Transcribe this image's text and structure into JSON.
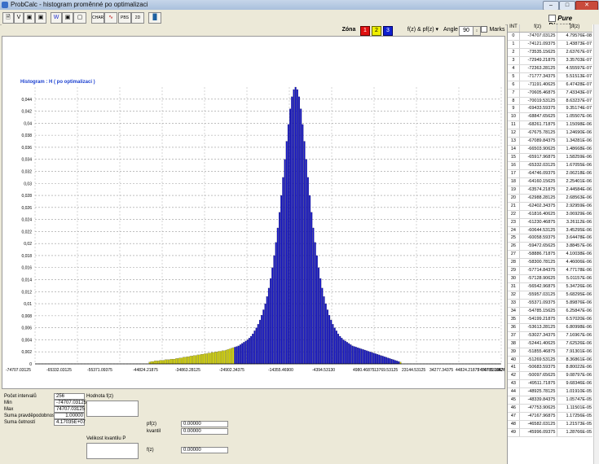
{
  "window": {
    "title": "ProbCalc - histogram proměnné po optimalizaci"
  },
  "toolbar": {
    "buttons": [
      "V",
      "CHAR",
      "PBS",
      "2D"
    ]
  },
  "pure_discrete_label": "Pure Discrete",
  "zone": {
    "label": "Zóna",
    "buttons": [
      "1",
      "2",
      "3"
    ],
    "colors": {
      "zone1": "#e01010",
      "zone2": "#f0f000",
      "zone3": "#1020d0"
    },
    "select_value": "f(z) & pf(z)",
    "angle_label": "Angle",
    "angle_value": "90",
    "marks_label": "Marks"
  },
  "chart_data": {
    "type": "bar",
    "title": "Histogram :  H ( po optimalizaci )",
    "ylim": [
      0,
      0.046
    ],
    "y_ticks": [
      "0",
      "0,002",
      "0,004",
      "0,006",
      "0,008",
      "0,01",
      "0,012",
      "0,014",
      "0,016",
      "0,018",
      "0,02",
      "0,022",
      "0,024",
      "0,026",
      "0,028",
      "0,03",
      "0,032",
      "0,034",
      "0,036",
      "0,038",
      "0,04",
      "0,042",
      "0,044"
    ],
    "x_tick_labels": [
      "-74707.03125",
      "-65332.03125",
      "-55371.09375",
      "-44824.21875",
      "-34863.28125",
      "-24902.34375",
      "-14355.46900",
      "-4394.53130",
      "4980.46875",
      "13769.53125",
      "23144.53125",
      "34277.34375",
      "44824.21875",
      "54785.15625",
      "64746.09375",
      "74707.03125"
    ],
    "x_labels_overlap": [
      "4980.46875",
      "13769.53125",
      "23144.53125",
      "34277.34375",
      "44824.21875",
      "54785.15625",
      "64746.09375"
    ],
    "n_bins": 256,
    "zone_colors": {
      "tail": "#d8d800",
      "center": "#1010c8"
    },
    "values": [
      0,
      0,
      0,
      0,
      0,
      0,
      0,
      0,
      0,
      0,
      0,
      0,
      0,
      0,
      0,
      0,
      0,
      0,
      0,
      0,
      0,
      0,
      0,
      0,
      0,
      0,
      0,
      0,
      0,
      0,
      0,
      0,
      0,
      0,
      0,
      0,
      0,
      0,
      0,
      0,
      0,
      0,
      0,
      0,
      0,
      0,
      0,
      0,
      0,
      0,
      0,
      0,
      0,
      0,
      0,
      0,
      0,
      0,
      0,
      0,
      0,
      0,
      0,
      0,
      0.0003,
      0.0004,
      0.0004,
      0.0005,
      0.0005,
      0.0005,
      0.0006,
      0.0006,
      0.0006,
      0.0007,
      0.0007,
      0.0007,
      0.0008,
      0.0008,
      0.0008,
      0.0009,
      0.0009,
      0.001,
      0.001,
      0.0011,
      0.0011,
      0.0012,
      0.0012,
      0.0013,
      0.0013,
      0.0014,
      0.0014,
      0.0015,
      0.0015,
      0.0016,
      0.0016,
      0.0017,
      0.0017,
      0.0018,
      0.0018,
      0.0019,
      0.0019,
      0.002,
      0.002,
      0.0021,
      0.0021,
      0.0022,
      0.0022,
      0.0023,
      0.0024,
      0.0025,
      0.0026,
      0.0027,
      0.0028,
      0.0029,
      0.003,
      0.0032,
      0.0034,
      0.0036,
      0.0038,
      0.004,
      0.0043,
      0.0046,
      0.005,
      0.0055,
      0.006,
      0.0066,
      0.0073,
      0.0081,
      0.009,
      0.01,
      0.0112,
      0.0126,
      0.0142,
      0.016,
      0.018,
      0.0202,
      0.0226,
      0.0252,
      0.028,
      0.031,
      0.034,
      0.037,
      0.0398,
      0.0424,
      0.0444,
      0.0456,
      0.046,
      0.0456,
      0.0444,
      0.0424,
      0.0398,
      0.037,
      0.034,
      0.031,
      0.028,
      0.0252,
      0.0226,
      0.0202,
      0.018,
      0.016,
      0.0142,
      0.0126,
      0.0112,
      0.01,
      0.009,
      0.0081,
      0.0073,
      0.0066,
      0.006,
      0.0055,
      0.005,
      0.0046,
      0.0043,
      0.004,
      0.0038,
      0.0036,
      0.0034,
      0.0032,
      0.003,
      0.0029,
      0.0028,
      0.0027,
      0.0026,
      0.0025,
      0.0024,
      0.0023,
      0.0022,
      0.0021,
      0.002,
      0.0019,
      0.0018,
      0.0017,
      0.0016,
      0.0015,
      0.0014,
      0.0013,
      0.0012,
      0.0011,
      0.001,
      0.0009,
      0.0008,
      0.0007,
      0.0006,
      0.0005,
      0.0004,
      0.0003,
      0,
      0,
      0,
      0,
      0,
      0,
      0,
      0,
      0,
      0,
      0,
      0,
      0,
      0,
      0,
      0,
      0,
      0,
      0,
      0,
      0,
      0,
      0,
      0,
      0,
      0,
      0,
      0,
      0,
      0,
      0,
      0,
      0,
      0,
      0,
      0,
      0,
      0,
      0,
      0,
      0,
      0,
      0,
      0,
      0,
      0,
      0,
      0,
      0,
      0,
      0,
      0,
      0,
      0,
      0,
      0
    ],
    "center_range": [
      112,
      204
    ]
  },
  "stats": {
    "rows": [
      {
        "label": "Počet intervalů",
        "value": "256"
      },
      {
        "label": "Min",
        "value": "-74707.03125"
      },
      {
        "label": "Max",
        "value": "74707.03125"
      },
      {
        "label": "Suma pravděpodobností",
        "value": "1.00000"
      },
      {
        "label": "Suma četností",
        "value": "4.17035E+07"
      }
    ],
    "hodnota_label": "Hodnota f(z)",
    "kvantil_label": "Velikost kvantilu P",
    "pf_label": "pf(z)",
    "pf_value": "0.00000",
    "kvantil_row_label": "kvantil",
    "kvantil_value": "0.00000",
    "fz_label": "f(z)",
    "fz_value": "0.00000"
  },
  "table": {
    "headers": [
      "INT",
      "f(z)",
      "pf(z)"
    ],
    "rows": [
      [
        "0",
        "-74707.03125",
        "4.79576E-08"
      ],
      [
        "1",
        "-74121.09375",
        "1.43873E-07"
      ],
      [
        "2",
        "-73535.15625",
        "2.63767E-07"
      ],
      [
        "3",
        "-72949.21875",
        "3.35703E-07"
      ],
      [
        "4",
        "-72363.28125",
        "4.55597E-07"
      ],
      [
        "5",
        "-71777.34375",
        "5.51513E-07"
      ],
      [
        "6",
        "-71191.40625",
        "6.47428E-07"
      ],
      [
        "7",
        "-70605.46875",
        "7.43343E-07"
      ],
      [
        "8",
        "-70019.53125",
        "8.63237E-07"
      ],
      [
        "9",
        "-69433.59375",
        "9.35174E-07"
      ],
      [
        "10",
        "-68847.65625",
        "1.05507E-06"
      ],
      [
        "11",
        "-68261.71875",
        "1.15098E-06"
      ],
      [
        "12",
        "-67675.78125",
        "1.24690E-06"
      ],
      [
        "13",
        "-67089.84375",
        "1.34281E-06"
      ],
      [
        "14",
        "-66503.90625",
        "1.48668E-06"
      ],
      [
        "15",
        "-65917.96875",
        "1.58259E-06"
      ],
      [
        "16",
        "-65332.03125",
        "1.67055E-06"
      ],
      [
        "17",
        "-64746.09375",
        "2.06218E-06"
      ],
      [
        "18",
        "-64160.15625",
        "2.25401E-06"
      ],
      [
        "19",
        "-63574.21875",
        "2.44584E-06"
      ],
      [
        "20",
        "-62988.28125",
        "2.68563E-06"
      ],
      [
        "21",
        "-62402.34375",
        "2.92959E-06"
      ],
      [
        "22",
        "-61816.40625",
        "3.06929E-06"
      ],
      [
        "23",
        "-61230.46875",
        "3.26112E-06"
      ],
      [
        "24",
        "-60644.53125",
        "3.45295E-06"
      ],
      [
        "25",
        "-60058.59375",
        "3.64478E-06"
      ],
      [
        "26",
        "-59472.65625",
        "3.88457E-06"
      ],
      [
        "27",
        "-58886.71875",
        "4.10038E-06"
      ],
      [
        "28",
        "-58300.78125",
        "4.46006E-06"
      ],
      [
        "29",
        "-57714.84375",
        "4.77178E-06"
      ],
      [
        "30",
        "-57128.90625",
        "5.01157E-06"
      ],
      [
        "31",
        "-56542.96875",
        "5.34726E-06"
      ],
      [
        "32",
        "-55957.03125",
        "5.68295E-06"
      ],
      [
        "33",
        "-55371.09375",
        "5.89876E-06"
      ],
      [
        "34",
        "-54785.15625",
        "6.25847E-06"
      ],
      [
        "35",
        "-54199.21875",
        "6.57020E-06"
      ],
      [
        "36",
        "-53613.28125",
        "6.80998E-06"
      ],
      [
        "37",
        "-53027.34375",
        "7.16967E-06"
      ],
      [
        "38",
        "-52441.40625",
        "7.62526E-06"
      ],
      [
        "39",
        "-51855.46875",
        "7.91301E-06"
      ],
      [
        "40",
        "-51269.53125",
        "8.36861E-06"
      ],
      [
        "41",
        "-50683.59375",
        "8.80022E-06"
      ],
      [
        "42",
        "-50097.65625",
        "9.08797E-06"
      ],
      [
        "43",
        "-49511.71875",
        "9.68346E-06"
      ],
      [
        "44",
        "-48925.78125",
        "1.01910E-05"
      ],
      [
        "45",
        "-48339.84375",
        "1.05747E-05"
      ],
      [
        "46",
        "-47753.90625",
        "1.11501E-05"
      ],
      [
        "47",
        "-47167.96875",
        "1.17256E-05"
      ],
      [
        "48",
        "-46582.03125",
        "1.21573E-05"
      ],
      [
        "49",
        "-45996.09375",
        "1.28766E-05"
      ]
    ]
  }
}
